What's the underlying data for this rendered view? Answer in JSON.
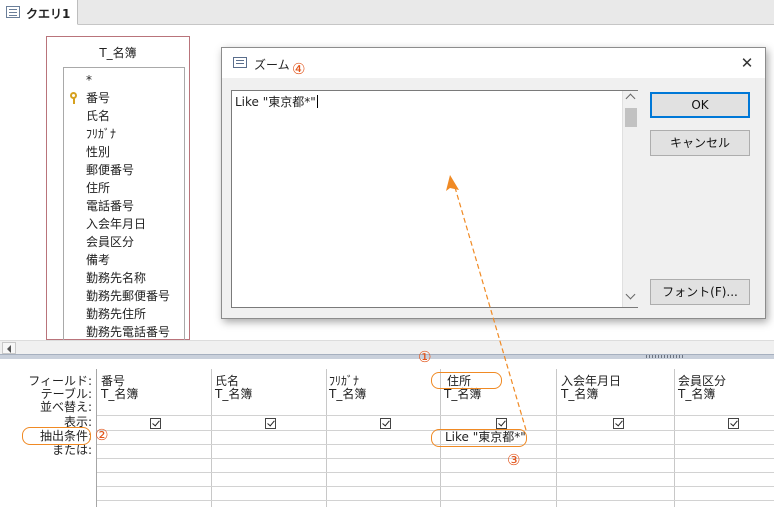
{
  "tab": {
    "title": "クエリ1"
  },
  "field_list": {
    "title": "T_名簿",
    "items": [
      "*",
      "番号",
      "氏名",
      "ﾌﾘｶﾞﾅ",
      "性別",
      "郵便番号",
      "住所",
      "電話番号",
      "入会年月日",
      "会員区分",
      "備考",
      "勤務先名称",
      "勤務先郵便番号",
      "勤務先住所",
      "勤務先電話番号"
    ]
  },
  "grid": {
    "row_labels": [
      "フィールド:",
      "テーブル:",
      "並べ替え:",
      "表示:",
      "抽出条件:",
      "または:"
    ],
    "columns": [
      {
        "field": "番号",
        "table": "T_名簿",
        "show": true,
        "criteria": ""
      },
      {
        "field": "氏名",
        "table": "T_名簿",
        "show": true,
        "criteria": ""
      },
      {
        "field": "ﾌﾘｶﾞﾅ",
        "table": "T_名簿",
        "show": true,
        "criteria": ""
      },
      {
        "field": "住所",
        "table": "T_名簿",
        "show": true,
        "criteria": "Like \"東京都*\""
      },
      {
        "field": "入会年月日",
        "table": "T_名簿",
        "show": true,
        "criteria": ""
      },
      {
        "field": "会員区分",
        "table": "T_名簿",
        "show": true,
        "criteria": ""
      }
    ]
  },
  "zoom": {
    "title": "ズーム",
    "text": "Like \"東京都*\"",
    "ok_label": "OK",
    "cancel_label": "キャンセル",
    "font_label": "フォント(F)...",
    "close_glyph": "✕"
  },
  "annotations": {
    "m1": "①",
    "m2": "②",
    "m3": "③",
    "m4": "④",
    "color": "#e2541a"
  }
}
